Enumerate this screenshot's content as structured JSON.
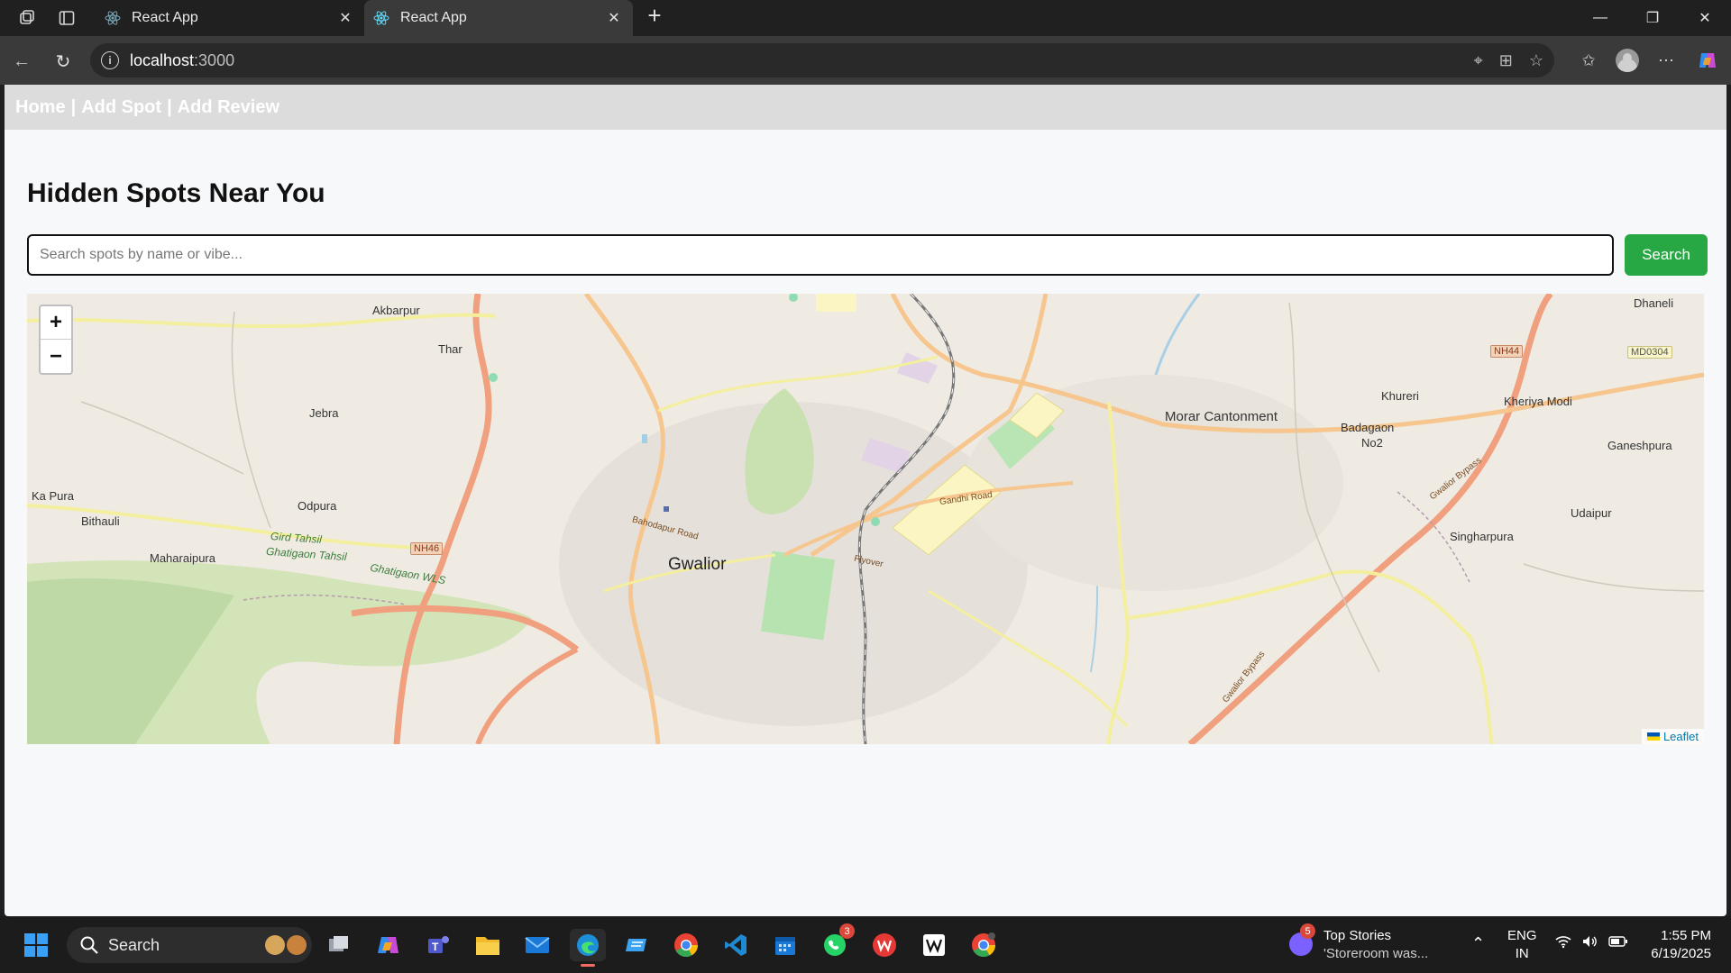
{
  "browser": {
    "tabs": [
      {
        "title": "React App",
        "active": false
      },
      {
        "title": "React App",
        "active": true
      }
    ],
    "url_host": "localhost",
    "url_port": ":3000"
  },
  "app": {
    "nav": {
      "home": "Home",
      "sep": "|",
      "add_spot": "Add Spot",
      "add_review": "Add Review"
    },
    "title": "Hidden Spots Near You",
    "search": {
      "placeholder": "Search spots by name or vibe...",
      "value": "",
      "button_label": "Search"
    },
    "map": {
      "zoom_in": "+",
      "zoom_out": "−",
      "attribution": "Leaflet",
      "labels": {
        "akbarpur": "Akbarpur",
        "thar": "Thar",
        "jebra": "Jebra",
        "ka_pura": "Ka Pura",
        "bithauli": "Bithauli",
        "odpura": "Odpura",
        "maharaipura": "Maharaipura",
        "gird_tahsil": "Gird Tahsil",
        "ghatigaon_tahsil": "Ghatigaon Tahsil",
        "ghatigaon_wls": "Ghatigaon WLS",
        "nh46": "NH46",
        "bahodapur_road": "Bahodapur Road",
        "gwalior": "Gwalior",
        "flyover": "Flyover",
        "gandhi_road": "Gandhi Road",
        "morar_cantonment": "Morar Cantonment",
        "khureri": "Khureri",
        "badagaon": "Badagaon",
        "no2": "No2",
        "nh44": "NH44",
        "md0304": "MD0304",
        "kheriya_modi": "Kheriya Modi",
        "dhaneli": "Dhaneli",
        "ganeshpura": "Ganeshpura",
        "udaipur": "Udaipur",
        "singharpura": "Singharpura",
        "gwalior_bypass_1": "Gwalior Bypass",
        "gwalior_bypass_2": "Gwalior Bypass"
      }
    }
  },
  "taskbar": {
    "search_label": "Search",
    "whatsapp_badge": "3",
    "news_badge": "5",
    "news_title": "Top Stories",
    "news_sub": "'Storeroom was...",
    "lang_1": "ENG",
    "lang_2": "IN",
    "time": "1:55 PM",
    "date": "6/19/2025"
  },
  "colors": {
    "search_button": "#28a745",
    "nav_bar": "#dcdcdc",
    "page_bg": "#f7f8fa",
    "map_bg": "#efebe3"
  }
}
